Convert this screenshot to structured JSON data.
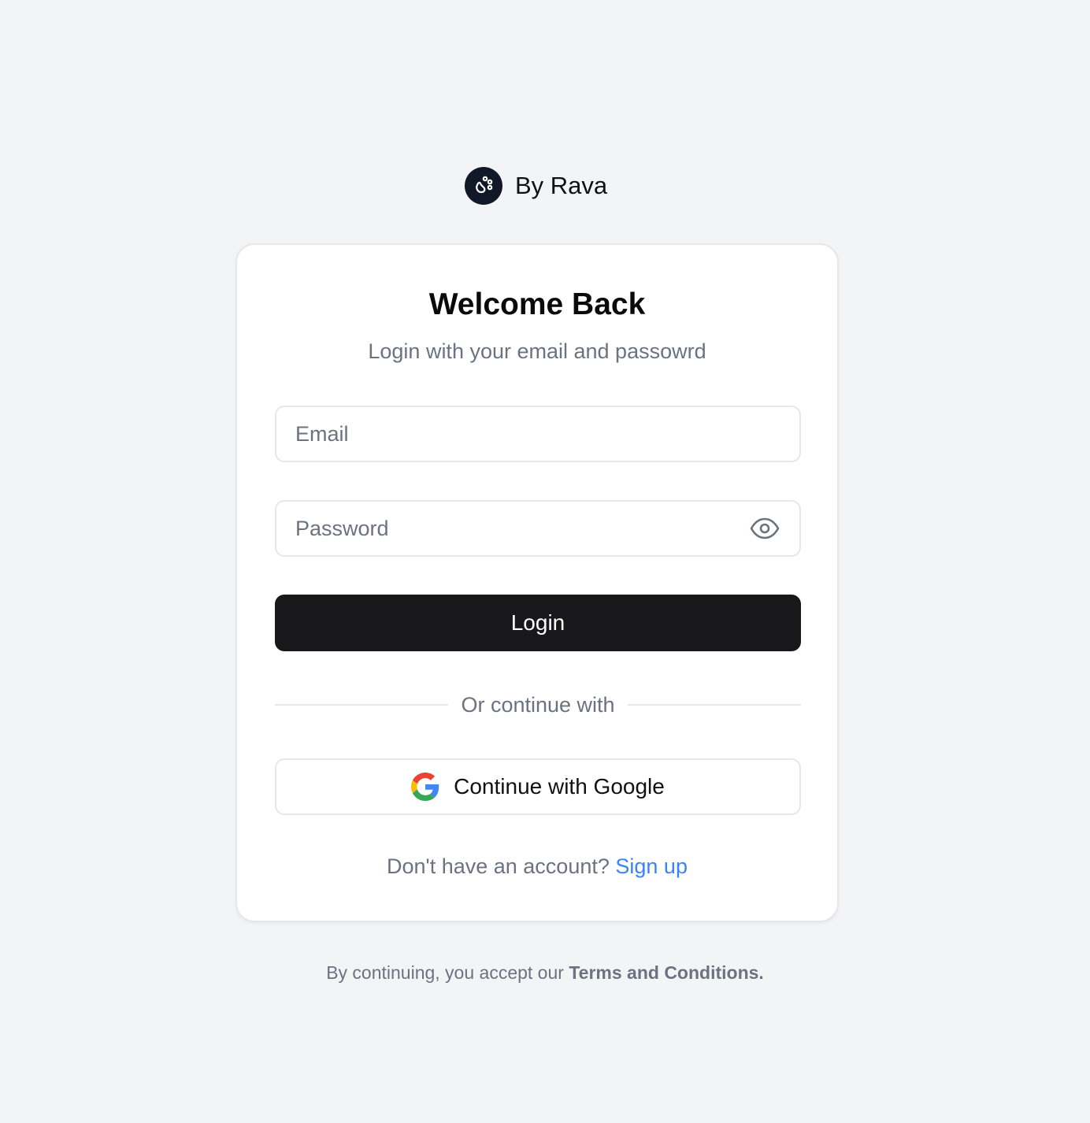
{
  "brand": {
    "name": "By Rava",
    "logo_icon": "paw-icon",
    "logo_bg": "#111827"
  },
  "card": {
    "title": "Welcome Back",
    "subtitle": "Login with your email and passowrd"
  },
  "email": {
    "placeholder": "Email",
    "value": ""
  },
  "password": {
    "placeholder": "Password",
    "value": "",
    "toggle_icon": "eye-icon"
  },
  "login_button": {
    "label": "Login",
    "bg": "#18181b"
  },
  "divider": {
    "label": "Or continue with"
  },
  "google_button": {
    "label": "Continue with Google",
    "icon": "google-icon"
  },
  "signup": {
    "prompt": "Don't have an account?",
    "link_label": "Sign up",
    "link_color": "#3b82f6"
  },
  "terms": {
    "prefix": "By continuing, you accept our",
    "link_label": "Terms and Conditions."
  }
}
